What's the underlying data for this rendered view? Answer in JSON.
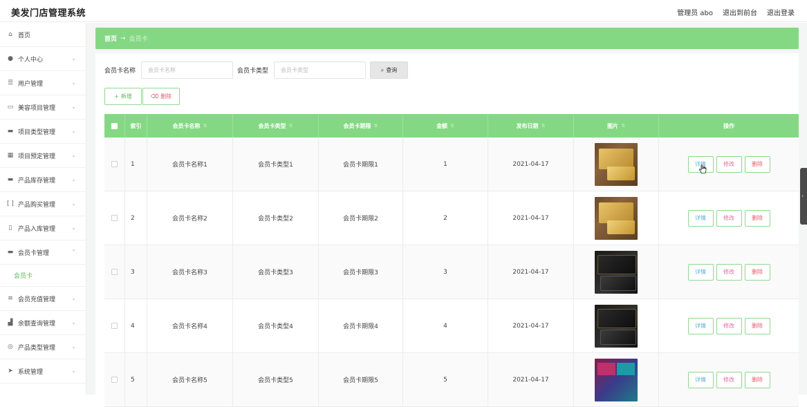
{
  "app": {
    "title": "美发门店管理系统",
    "admin_label": "管理员 abo",
    "to_front_label": "退出到前台",
    "logout_label": "退出登录"
  },
  "sidebar": {
    "items": [
      {
        "label": "首页",
        "icon": "home-icon",
        "has_chevron": false
      },
      {
        "label": "个人中心",
        "icon": "user-icon",
        "has_chevron": true
      },
      {
        "label": "用户管理",
        "icon": "sliders-icon",
        "has_chevron": true
      },
      {
        "label": "美容项目管理",
        "icon": "chat-icon",
        "has_chevron": true
      },
      {
        "label": "项目类型管理",
        "icon": "monitor-icon",
        "has_chevron": true
      },
      {
        "label": "项目预定管理",
        "icon": "grid-icon",
        "has_chevron": true
      },
      {
        "label": "产品库存管理",
        "icon": "monitor-icon",
        "has_chevron": true
      },
      {
        "label": "产品购买管理",
        "icon": "bracket-icon",
        "has_chevron": true
      },
      {
        "label": "产品入库管理",
        "icon": "phone-icon",
        "has_chevron": true
      },
      {
        "label": "会员卡管理",
        "icon": "monitor-icon",
        "has_chevron": true,
        "expanded": true
      },
      {
        "label": "会员充值管理",
        "icon": "list-icon",
        "has_chevron": true
      },
      {
        "label": "余额查询管理",
        "icon": "chart-icon",
        "has_chevron": true
      },
      {
        "label": "产品类型管理",
        "icon": "compass-icon",
        "has_chevron": true
      },
      {
        "label": "系统管理",
        "icon": "send-icon",
        "has_chevron": true
      }
    ],
    "submenu": {
      "label": "会员卡"
    }
  },
  "breadcrumb": {
    "home": "首页",
    "arrow": "→",
    "current": "会员卡"
  },
  "search": {
    "name_label": "会员卡名称",
    "name_placeholder": "会员卡名称",
    "type_label": "会员卡类型",
    "type_placeholder": "会员卡类型",
    "query_label": "查询"
  },
  "actions": {
    "add_label": "新增",
    "delete_label": "删除"
  },
  "table": {
    "columns": [
      "索引",
      "会员卡名称",
      "会员卡类型",
      "会员卡期限",
      "金额",
      "发布日期",
      "图片",
      "操作"
    ],
    "rows": [
      {
        "index": "1",
        "name": "会员卡名称1",
        "type": "会员卡类型1",
        "term": "会员卡期限1",
        "amount": "1",
        "date": "2021-04-17",
        "image": "gold"
      },
      {
        "index": "2",
        "name": "会员卡名称2",
        "type": "会员卡类型2",
        "term": "会员卡期限2",
        "amount": "2",
        "date": "2021-04-17",
        "image": "gold"
      },
      {
        "index": "3",
        "name": "会员卡名称3",
        "type": "会员卡类型3",
        "term": "会员卡期限3",
        "amount": "3",
        "date": "2021-04-17",
        "image": "black"
      },
      {
        "index": "4",
        "name": "会员卡名称4",
        "type": "会员卡类型4",
        "term": "会员卡期限4",
        "amount": "4",
        "date": "2021-04-17",
        "image": "black"
      },
      {
        "index": "5",
        "name": "会员卡名称5",
        "type": "会员卡类型5",
        "term": "会员卡期限5",
        "amount": "5",
        "date": "2021-04-17",
        "image": "mixed"
      }
    ],
    "op_detail": "详情",
    "op_edit": "修改",
    "op_delete": "删除"
  },
  "colors": {
    "accent": "#84d884",
    "danger": "#e0626e"
  }
}
